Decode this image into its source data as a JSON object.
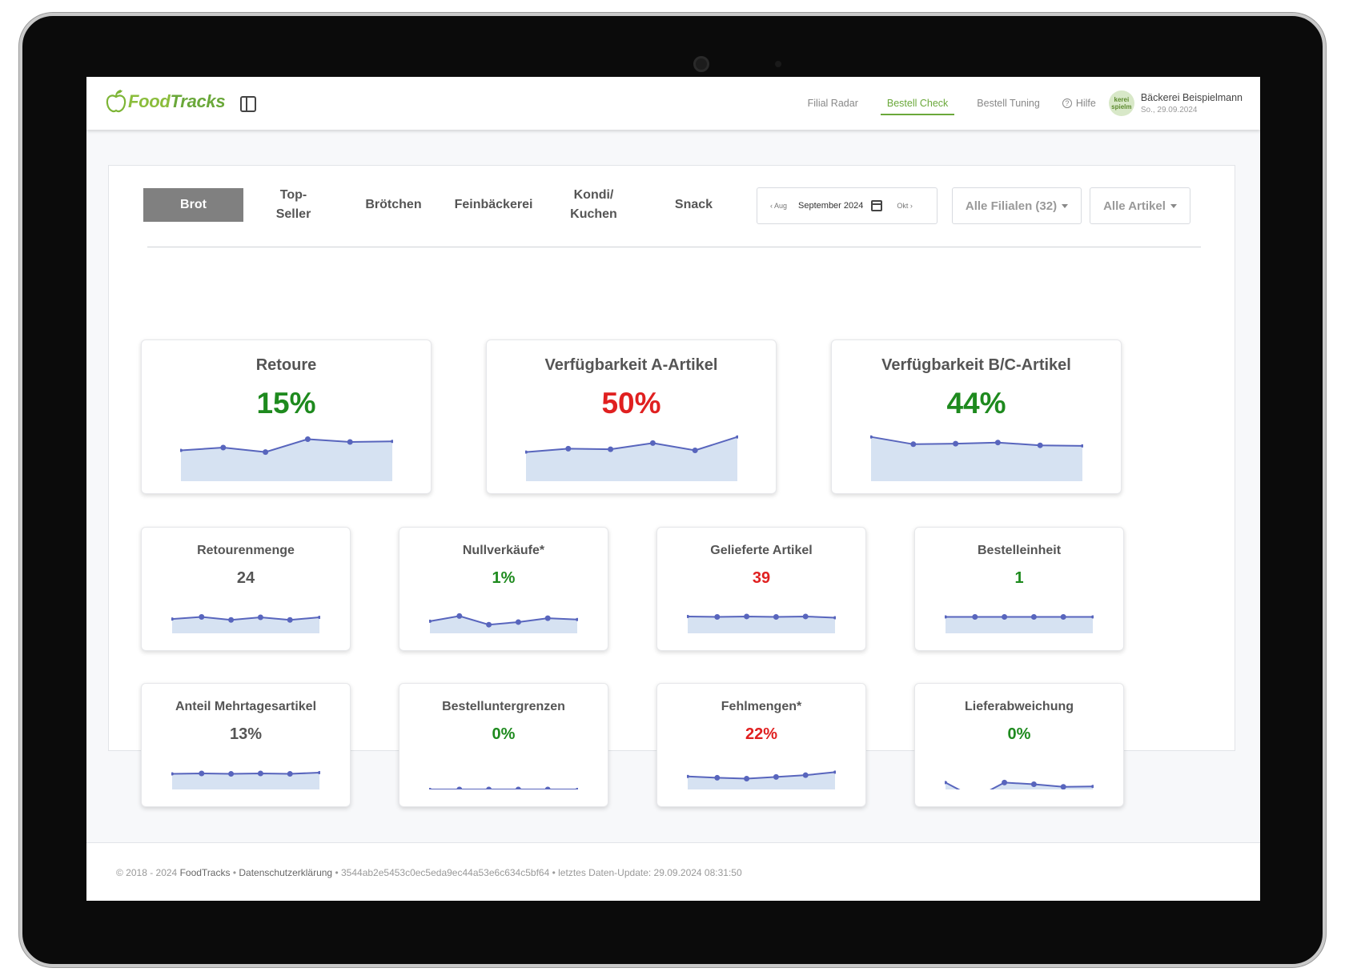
{
  "navbar": {
    "logo_food": "Food",
    "logo_tracks": "Tracks",
    "links": [
      "Filial Radar",
      "Bestell Check",
      "Bestell Tuning"
    ],
    "active_link": "Bestell Check",
    "help": "Hilfe",
    "avatar_text": "kerei spielm",
    "user_name": "Bäckerei Beispielmann",
    "user_date": "So., 29.09.2024"
  },
  "toolbar": {
    "tabs": [
      "Brot",
      "Top-\nSeller",
      "Brötchen",
      "Feinbäckerei",
      "Kondi/\nKuchen",
      "Snack"
    ],
    "active_tab": "Brot",
    "date_prev": "Aug",
    "date_month": "September 2024",
    "date_next": "Okt",
    "filialen": "Alle Filialen (32)",
    "artikel": "Alle Artikel"
  },
  "kpis_big": [
    {
      "title": "Retoure",
      "value": "15%",
      "status": "green",
      "trend": [
        0.55,
        0.6,
        0.52,
        0.75,
        0.7,
        0.71
      ]
    },
    {
      "title": "Verfügbarkeit A-Artikel",
      "value": "50%",
      "status": "red",
      "trend": [
        0.52,
        0.58,
        0.57,
        0.68,
        0.55,
        0.79
      ]
    },
    {
      "title": "Verfügbarkeit B/C-Artikel",
      "value": "44%",
      "status": "green",
      "trend": [
        0.79,
        0.66,
        0.67,
        0.69,
        0.64,
        0.63
      ]
    }
  ],
  "kpis_small": [
    {
      "title": "Retourenmenge",
      "value": "24",
      "status": "neutral",
      "trend": [
        0.33,
        0.38,
        0.31,
        0.37,
        0.31,
        0.37
      ],
      "fill": true
    },
    {
      "title": "Nullverkäufe*",
      "value": "1%",
      "status": "green",
      "trend": [
        0.28,
        0.4,
        0.2,
        0.26,
        0.35,
        0.32
      ],
      "fill": true
    },
    {
      "title": "Gelieferte Artikel",
      "value": "39",
      "status": "red",
      "trend": [
        0.39,
        0.38,
        0.39,
        0.38,
        0.39,
        0.36
      ],
      "fill": true
    },
    {
      "title": "Bestelleinheit",
      "value": "1",
      "status": "green",
      "trend": [
        0.38,
        0.38,
        0.38,
        0.38,
        0.38,
        0.38
      ],
      "fill": true
    },
    {
      "title": "Anteil Mehrtagesartikel",
      "value": "13%",
      "status": "neutral",
      "trend": [
        0.36,
        0.37,
        0.36,
        0.37,
        0.36,
        0.39
      ],
      "fill": true
    },
    {
      "title": "Bestelluntergrenzen",
      "value": "0%",
      "status": "green",
      "trend": [
        0.0,
        0.0,
        0.0,
        0.0,
        0.0,
        0.0
      ],
      "fill": false
    },
    {
      "title": "Fehlmengen*",
      "value": "22%",
      "status": "red",
      "trend": [
        0.3,
        0.27,
        0.25,
        0.29,
        0.33,
        0.4
      ],
      "fill": true
    },
    {
      "title": "Lieferabweichung",
      "value": "0%",
      "status": "green",
      "trend": [
        0.16,
        -0.2,
        0.16,
        0.12,
        0.06,
        0.07
      ],
      "fill": true
    }
  ],
  "footer": {
    "copyright": "© 2018 - 2024",
    "brand": "FoodTracks",
    "privacy": "Datenschutzerklärung",
    "hash": "3544ab2e5453c0ec5eda9ec44a53e6c634c5bf64",
    "update": "letztes Daten-Update: 29.09.2024 08:31:50"
  },
  "colors": {
    "accent": "#6aa83a",
    "good": "#1e8a1e",
    "bad": "#e02020",
    "line": "#5865bd",
    "area": "#d6e2f2"
  }
}
